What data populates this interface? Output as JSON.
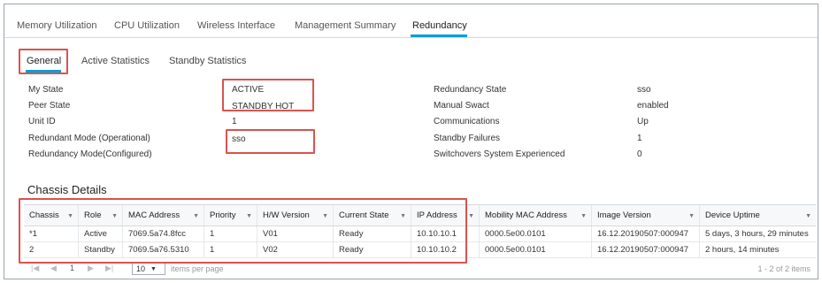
{
  "tabs": [
    {
      "label": "Memory Utilization"
    },
    {
      "label": "CPU Utilization"
    },
    {
      "label": "Wireless Interface"
    },
    {
      "label": "Management Summary"
    },
    {
      "label": "Redundancy"
    }
  ],
  "subtabs": [
    {
      "label": "General"
    },
    {
      "label": "Active Statistics"
    },
    {
      "label": "Standby Statistics"
    }
  ],
  "general_left": [
    {
      "label": "My State",
      "value": "ACTIVE"
    },
    {
      "label": "Peer State",
      "value": "STANDBY HOT"
    },
    {
      "label": "Unit ID",
      "value": "1"
    },
    {
      "label": "Redundant Mode (Operational)",
      "value": "sso"
    },
    {
      "label": "Redundancy Mode(Configured)",
      "value": ""
    }
  ],
  "general_right": [
    {
      "label": "Redundancy State",
      "value": "sso"
    },
    {
      "label": "Manual Swact",
      "value": "enabled"
    },
    {
      "label": "Communications",
      "value": "Up"
    },
    {
      "label": "Standby Failures",
      "value": "1"
    },
    {
      "label": "Switchovers System Experienced",
      "value": "0"
    }
  ],
  "chassis": {
    "title": "Chassis Details",
    "columns": [
      "Chassis",
      "Role",
      "MAC Address",
      "Priority",
      "H/W Version",
      "Current State",
      "IP Address",
      "Mobility MAC Address",
      "Image Version",
      "Device Uptime"
    ],
    "rows": [
      [
        "*1",
        "Active",
        "7069.5a74.8fcc",
        "1",
        "V01",
        "Ready",
        "10.10.10.1",
        "0000.5e00.0101",
        "16.12.20190507:000947",
        "5 days, 3 hours, 29 minutes"
      ],
      [
        "2",
        "Standby",
        "7069.5a76.5310",
        "1",
        "V02",
        "Ready",
        "10.10.10.2",
        "0000.5e00.0101",
        "16.12.20190507:000947",
        "2 hours, 14 minutes"
      ]
    ]
  },
  "pager": {
    "page": "1",
    "page_size": "10",
    "per_page_label": "items per page",
    "range_text": "1 - 2 of 2 items"
  },
  "colors": {
    "accent": "#049fd9",
    "highlight": "#d9534f"
  }
}
